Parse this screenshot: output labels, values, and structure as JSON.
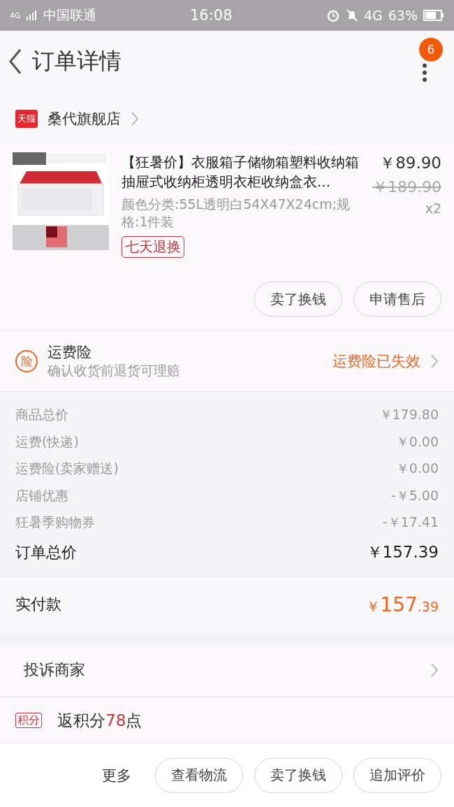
{
  "status_bar": {
    "network": "4G",
    "carrier": "中国联通",
    "time": "16:08",
    "network_type": "4G",
    "battery": "63%"
  },
  "header": {
    "title": "订单详情",
    "badge": "6"
  },
  "shop": {
    "tag": "天猫",
    "name": "桑代旗舰店"
  },
  "product": {
    "image": {
      "kind": "picture"
    },
    "title": "【狂暑价】衣服箱子储物箱塑料收纳箱抽屉式收纳柜透明衣柜收纳盒衣...",
    "specs": "颜色分类:55L透明白54X47X24cm;规格:1件装",
    "tag": "七天退换",
    "price": "￥89.90",
    "original_price": "￥189.90",
    "quantity": "x2",
    "buttons": [
      "卖了换钱",
      "申请售后"
    ]
  },
  "insurance": {
    "icon": "险",
    "title": "运费险",
    "subtitle": "确认收货前退货可理赔",
    "status": "运费险已失效"
  },
  "price_rows": [
    {
      "label": "商品总价",
      "value": "￥179.80"
    },
    {
      "label": "运费(快递)",
      "value": "￥0.00"
    },
    {
      "label": "运费险(卖家赠送)",
      "value": "￥0.00"
    },
    {
      "label": "店铺优惠",
      "value": "-￥5.00"
    },
    {
      "label": "狂暑季购物券",
      "value": "-￥17.41"
    }
  ],
  "order_total": {
    "label": "订单总价",
    "value": "￥157.39"
  },
  "paid": {
    "label": "实付款",
    "currency": "￥",
    "integer": "157",
    "decimal": ".39"
  },
  "complaint": {
    "label": "投诉商家"
  },
  "points": {
    "tag": "积分",
    "prefix": "返积分",
    "amount": "78",
    "suffix": "点"
  },
  "bottom_bar": {
    "more": "更多",
    "buttons": [
      "查看物流",
      "卖了换钱",
      "追加评价"
    ]
  }
}
